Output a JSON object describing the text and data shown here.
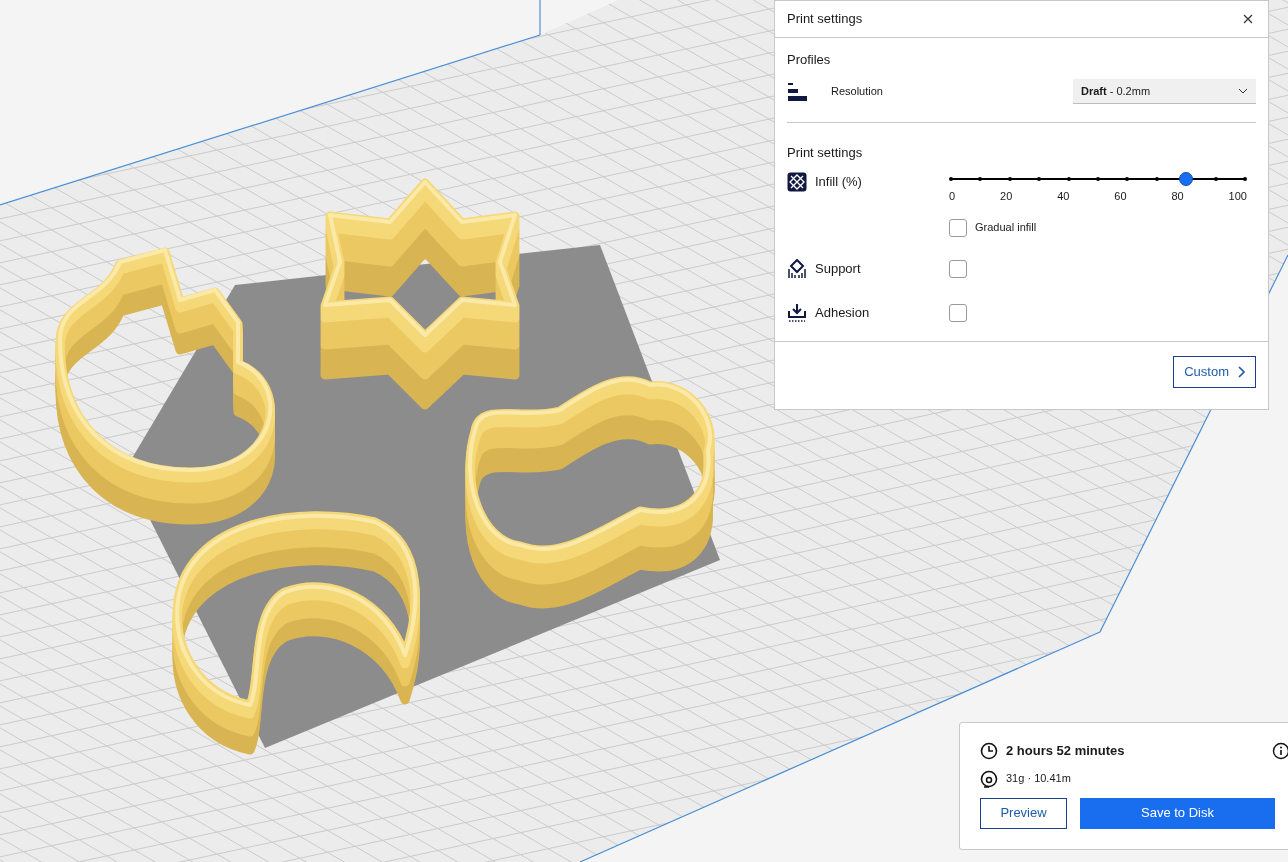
{
  "print_settings": {
    "title": "Print settings",
    "profiles": {
      "heading": "Profiles",
      "resolution": {
        "label": "Resolution",
        "value": "**Draft** - 0.2mm"
      }
    },
    "settings_heading": "Print settings",
    "infill": {
      "label": "Infill (%)",
      "level": 0.8,
      "tick_labels": [
        "0",
        "20",
        "40",
        "60",
        "80",
        "100"
      ],
      "gradual": {
        "label": "Gradual infill",
        "checked": false
      }
    },
    "support": {
      "label": "Support",
      "checked": false
    },
    "adhesion": {
      "label": "Adhesion",
      "checked": false
    },
    "custom_button": "Custom"
  },
  "summary": {
    "time": "2 hours 52 minutes",
    "material": "31g · 10.41m",
    "preview_button": "Preview",
    "save_button": "Save to Disk"
  }
}
